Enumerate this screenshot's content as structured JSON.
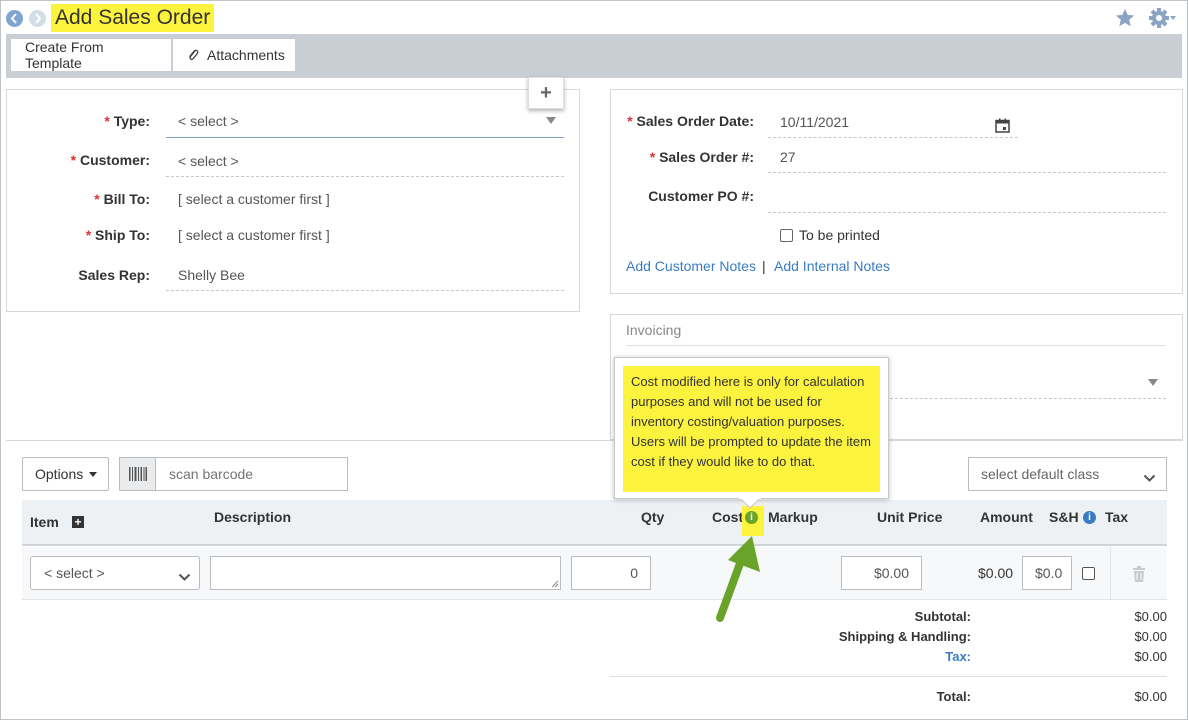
{
  "header": {
    "title": "Add Sales Order",
    "back_icon": "arrow-left-icon",
    "forward_icon": "arrow-right-icon",
    "favorite_icon": "star-icon",
    "settings_icon": "gear-icon"
  },
  "toolbar": {
    "create_from_template": "Create From Template",
    "attachments": "Attachments"
  },
  "left_panel": {
    "type_label": "Type:",
    "type_value": "< select >",
    "customer_label": "Customer:",
    "customer_value": "< select >",
    "bill_to_label": "Bill To:",
    "bill_to_value": "[ select a customer first ]",
    "ship_to_label": "Ship To:",
    "ship_to_value": "[ select a customer first ]",
    "sales_rep_label": "Sales Rep:",
    "sales_rep_value": "Shelly Bee",
    "add_button": "+",
    "required_mark": "*"
  },
  "right_panel": {
    "order_date_label": "Sales Order Date:",
    "order_date_value": "10/11/2021",
    "order_number_label": "Sales Order #:",
    "order_number_value": "27",
    "customer_po_label": "Customer PO #:",
    "customer_po_value": "",
    "to_be_printed_label": "To be printed",
    "to_be_printed_checked": false,
    "add_customer_notes": "Add Customer Notes",
    "separator": "|",
    "add_internal_notes": "Add Internal Notes"
  },
  "invoicing": {
    "title": "Invoicing"
  },
  "tooltip": {
    "text": "Cost modified here is only for calculation purposes and will not be used for inventory costing/valuation purposes. Users will be prompted to update the item cost if they would like to do that."
  },
  "lines_toolbar": {
    "options_label": "Options",
    "scan_placeholder": "scan barcode",
    "default_class_placeholder": "select default class"
  },
  "table": {
    "headers": {
      "item": "Item",
      "description": "Description",
      "qty": "Qty",
      "cost": "Cost",
      "markup": "Markup",
      "unit_price": "Unit Price",
      "amount": "Amount",
      "sh": "S&H",
      "tax": "Tax"
    },
    "row": {
      "item_select": "< select >",
      "description": "",
      "qty": "0",
      "unit_price": "$0.00",
      "amount": "$0.00",
      "sh_value": "$0.0",
      "taxable": false
    }
  },
  "totals": {
    "subtotal_label": "Subtotal:",
    "subtotal_value": "$0.00",
    "shipping_label": "Shipping & Handling:",
    "shipping_value": "$0.00",
    "tax_label": "Tax:",
    "tax_value": "$0.00",
    "total_label": "Total:",
    "total_value": "$0.00"
  },
  "colors": {
    "highlight": "#fbf33d",
    "toolbar_bg": "#c9ced5",
    "link": "#3a7cc1",
    "required": "#dd3333",
    "arrow": "#6aa32a"
  }
}
